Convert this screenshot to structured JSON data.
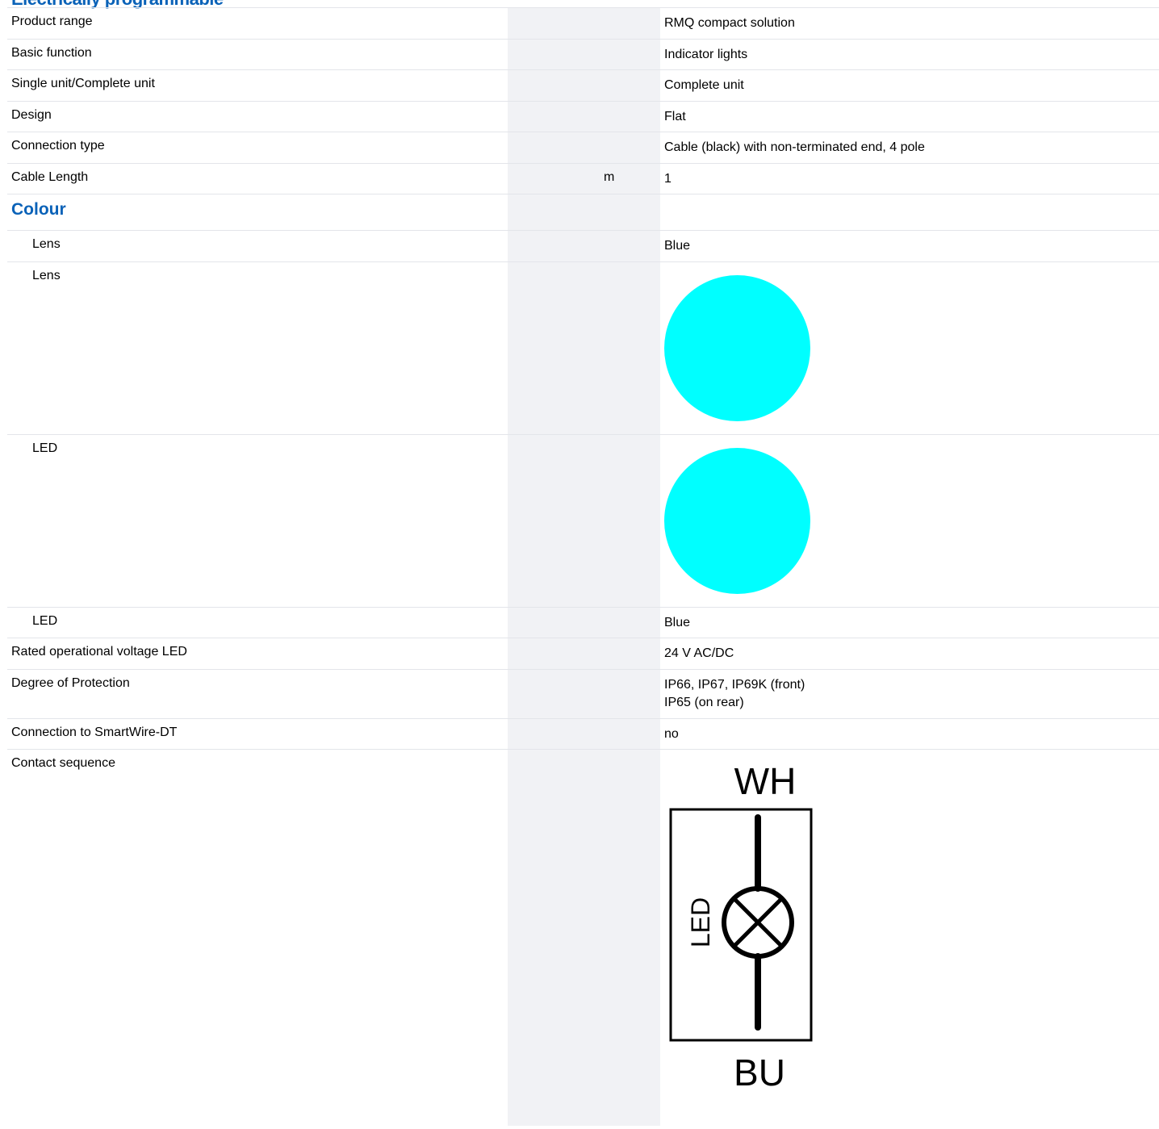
{
  "header": {
    "cut_title": "Electrically programmable"
  },
  "rows": [
    {
      "label": "Product range",
      "unit": "",
      "value": "RMQ compact solution"
    },
    {
      "label": "Basic function",
      "unit": "",
      "value": "Indicator lights"
    },
    {
      "label": "Single unit/Complete unit",
      "unit": "",
      "value": "Complete unit"
    },
    {
      "label": "Design",
      "unit": "",
      "value": "Flat"
    },
    {
      "label": "Connection type",
      "unit": "",
      "value": "Cable (black) with non-terminated end, 4 pole"
    },
    {
      "label": "Cable Length",
      "unit": "m",
      "value": "1"
    }
  ],
  "colour_section": {
    "title": "Colour",
    "lens_label": "Lens",
    "lens_value": "Blue",
    "lens_swatch_label": "Lens",
    "lens_swatch_color": "#00ffff",
    "led_swatch_label": "LED",
    "led_swatch_color": "#00ffff",
    "led_label": "LED",
    "led_value": "Blue"
  },
  "rows2": [
    {
      "label": "Rated operational voltage LED",
      "unit": "",
      "value": "24 V AC/DC"
    }
  ],
  "protection": {
    "label": "Degree of Protection",
    "value_line1": "IP66, IP67, IP69K (front)",
    "value_line2": "IP65 (on rear)"
  },
  "smartwire": {
    "label": "Connection to SmartWire-DT",
    "value": "no"
  },
  "contact": {
    "label": "Contact sequence",
    "diagram": {
      "top_label": "WH",
      "bottom_label": "BU",
      "side_label": "LED"
    }
  },
  "colors": {
    "accent": "#0a62b8",
    "shade": "#f1f2f5",
    "border": "#e3e5ea"
  }
}
